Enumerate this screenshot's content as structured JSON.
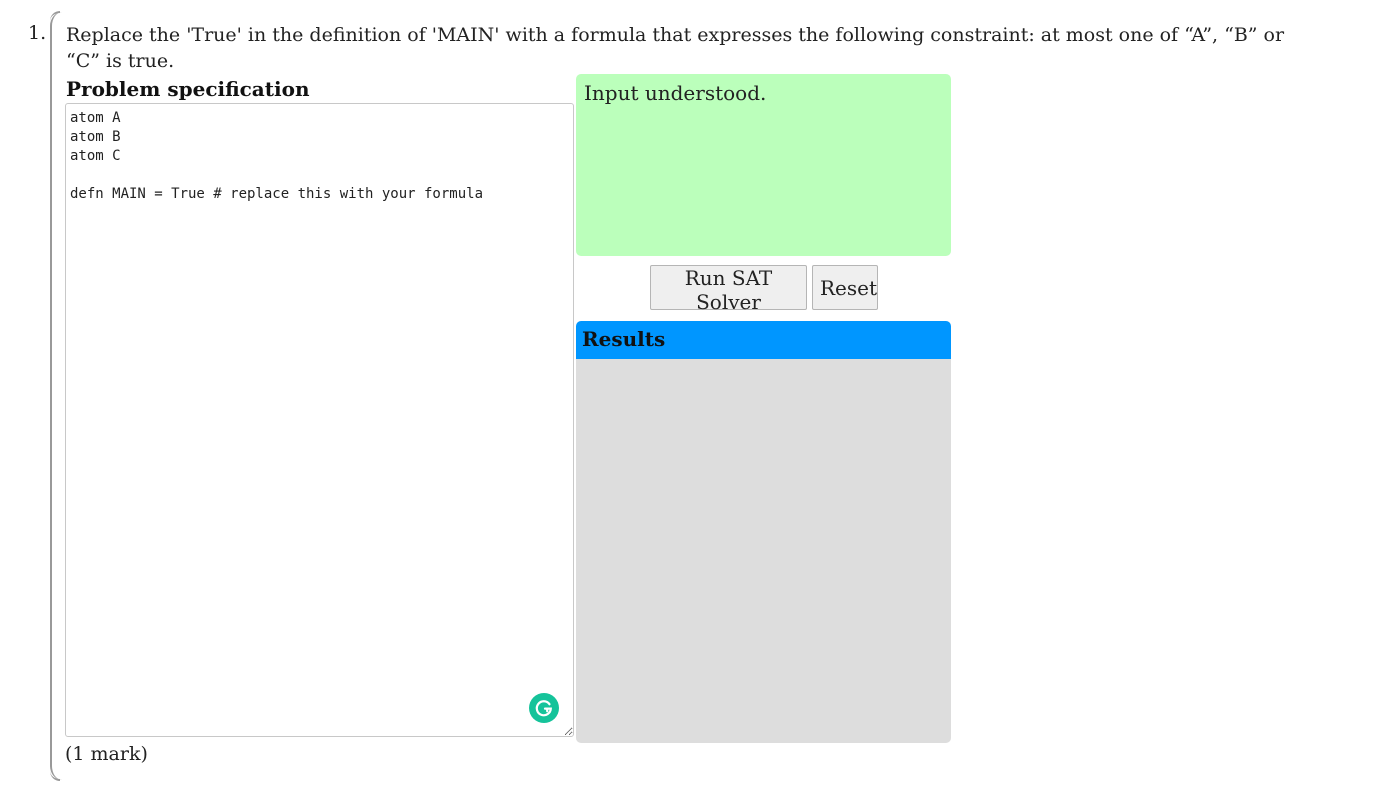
{
  "question": {
    "number": "1.",
    "text": "Replace the 'True' in the definition of 'MAIN' with a formula that expresses the following constraint: at most one of “A”, “B” or “C” is true.",
    "marks": "(1 mark)"
  },
  "spec": {
    "heading": "Problem specification",
    "content": "atom A\natom B\natom C\n\ndefn MAIN = True # replace this with your formula"
  },
  "status": {
    "message": "Input understood.",
    "color": "#bbffbb"
  },
  "buttons": {
    "run_label": "Run SAT Solver",
    "reset_label": "Reset"
  },
  "results": {
    "heading": "Results",
    "header_color": "#0096ff",
    "body_color": "#dddddd"
  },
  "icons": {
    "grammarly": "grammarly-icon"
  }
}
